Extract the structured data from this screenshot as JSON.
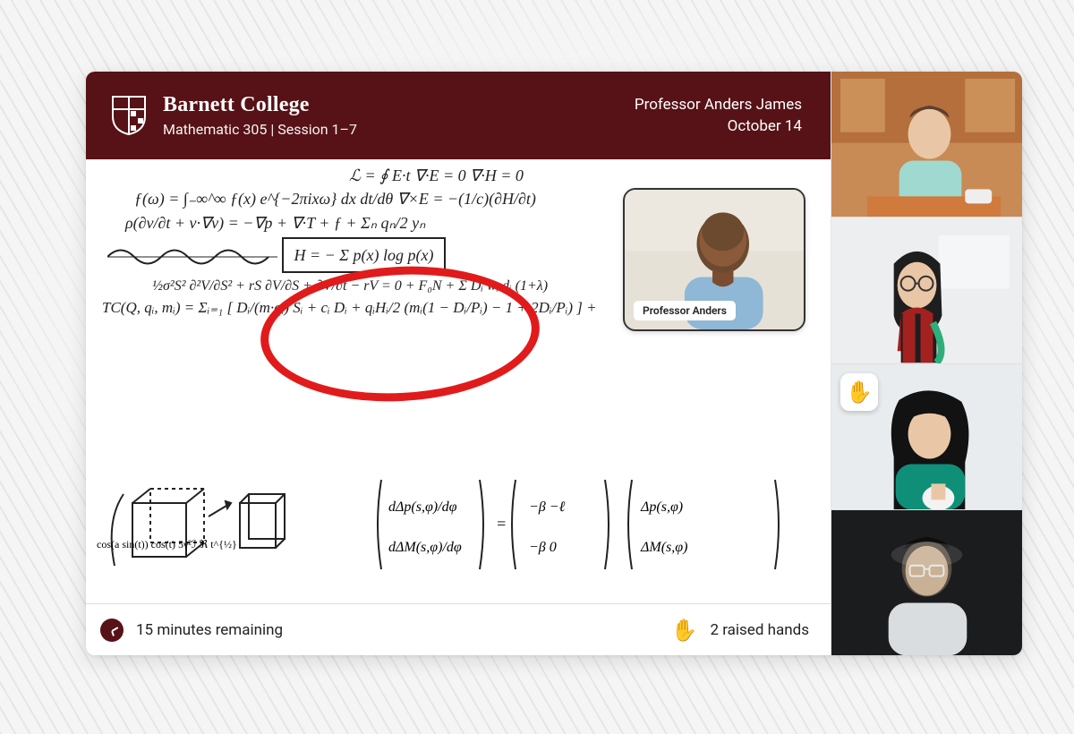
{
  "header": {
    "college": "Barnett College",
    "course_line": "Mathematic 305 | Session 1–7",
    "professor": "Professor Anders James",
    "date": "October 14"
  },
  "presenter": {
    "label": "Professor Anders"
  },
  "footer": {
    "time_remaining": "15 minutes remaining",
    "raised_hands": "2 raised hands"
  },
  "participants": [
    {
      "id": "participant-1",
      "raised": false
    },
    {
      "id": "participant-2",
      "raised": false
    },
    {
      "id": "participant-3",
      "raised": true
    },
    {
      "id": "participant-4",
      "raised": false
    }
  ],
  "icons": {
    "clock": "clock-icon",
    "hand": "raised-hand-icon",
    "shield": "college-shield-icon"
  },
  "whiteboard": {
    "lines": [
      "ℒ = ∮ E·t      ∇·E = 0    ∇·H = 0",
      "ƒ(ω) = ∫₋∞^∞ ƒ(x) e^{−2πixω} dx   dt/dθ   ∇×E = −(1/c)(∂H/∂t)",
      "ρ(∂v/∂t + v·∇v) = −∇p + ∇·T + ƒ   +  Σₙ qₙ/2   yₙ",
      "H = − Σ p(x) log p(x)",
      "½σ²S² ∂²V/∂S² + rS ∂V/∂S + ∂V/∂t − rV = 0   + F₀N + Σ Dᵢ wᵢ dᵢ (1+λ)",
      "TC(Q, qᵢ, mᵢ) = Σᵢ₌₁ [ Dᵢ/(m·qᵢ) Sᵢ + cᵢ Dᵢ + qᵢHᵢ/2 (mᵢ(1 − Dᵢ/Pᵢ) − 1 + 2Dᵢ/Pᵢ) ] +",
      "cos(a sin(t)) cos(t)   5γ²ℐ   ℜ t^{½}",
      "[ dΔp(s,φ)/dφ ; dΔM(s,φ)/dφ ] = [ −β  −ℓ ; −β  0 ][ Δp(s,φ) ; ΔM(s,φ) ]"
    ],
    "highlighted_equation_index": 3
  },
  "colors": {
    "brand": "#561216",
    "highlight": "#e11b1b",
    "hand": "#f0a020"
  }
}
